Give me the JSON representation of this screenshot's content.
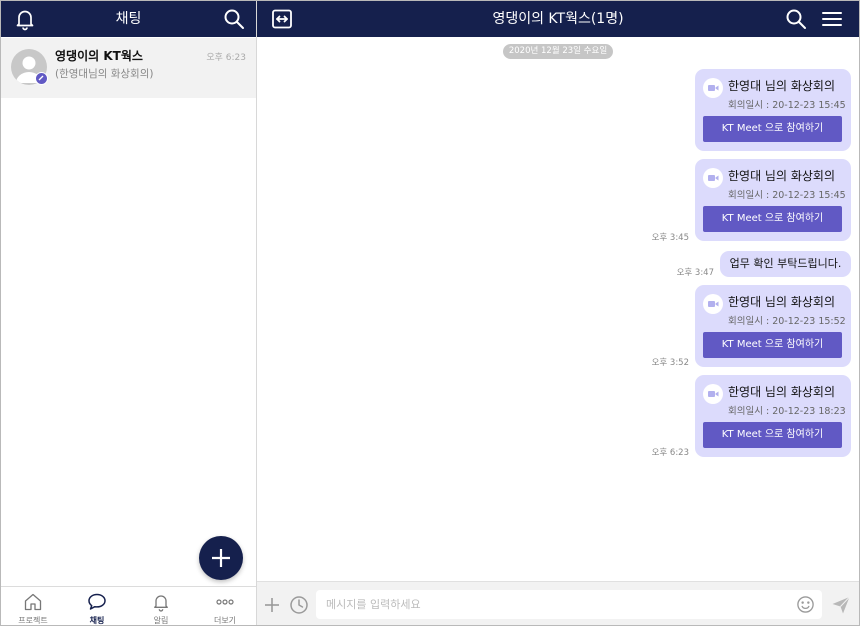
{
  "left": {
    "title": "채팅",
    "chat": {
      "name": "영댕이의 KT웍스",
      "preview": "(한영대님의 화상회의)",
      "time": "오후 6:23"
    },
    "nav": [
      {
        "label": "프로젝트",
        "icon": "home-icon"
      },
      {
        "label": "채팅",
        "icon": "chat-bubble-icon"
      },
      {
        "label": "알림",
        "icon": "bell-icon"
      },
      {
        "label": "더보기",
        "icon": "more-dots-icon"
      }
    ]
  },
  "right": {
    "title": "영댕이의 KT웍스(1명)",
    "date_divider": "2020년 12월 23일 수요일",
    "messages": [
      {
        "title": "한영대  님의 화상회의",
        "date": "회의일시 : 20-12-23 15:45",
        "button": "KT Meet 으로 참여하기",
        "time": ""
      },
      {
        "title": "한영대  님의 화상회의",
        "date": "회의일시 : 20-12-23 15:45",
        "button": "KT Meet 으로 참여하기",
        "time": "오후 3:45"
      },
      {
        "text": "업무 확인 부탁드립니다.",
        "time": "오후 3:47"
      },
      {
        "title": "한영대  님의 화상회의",
        "date": "회의일시 : 20-12-23 15:52",
        "button": "KT Meet 으로 참여하기",
        "time": "오후 3:52"
      },
      {
        "title": "한영대  님의 화상회의",
        "date": "회의일시 : 20-12-23 18:23",
        "button": "KT Meet 으로 참여하기",
        "time": "오후 6:23"
      }
    ],
    "input_placeholder": "메시지를 입력하세요"
  },
  "colors": {
    "header": "#15204d",
    "bubble": "#dcdbfc",
    "button": "#6159c4",
    "date_pill": "#c6c6c6"
  }
}
